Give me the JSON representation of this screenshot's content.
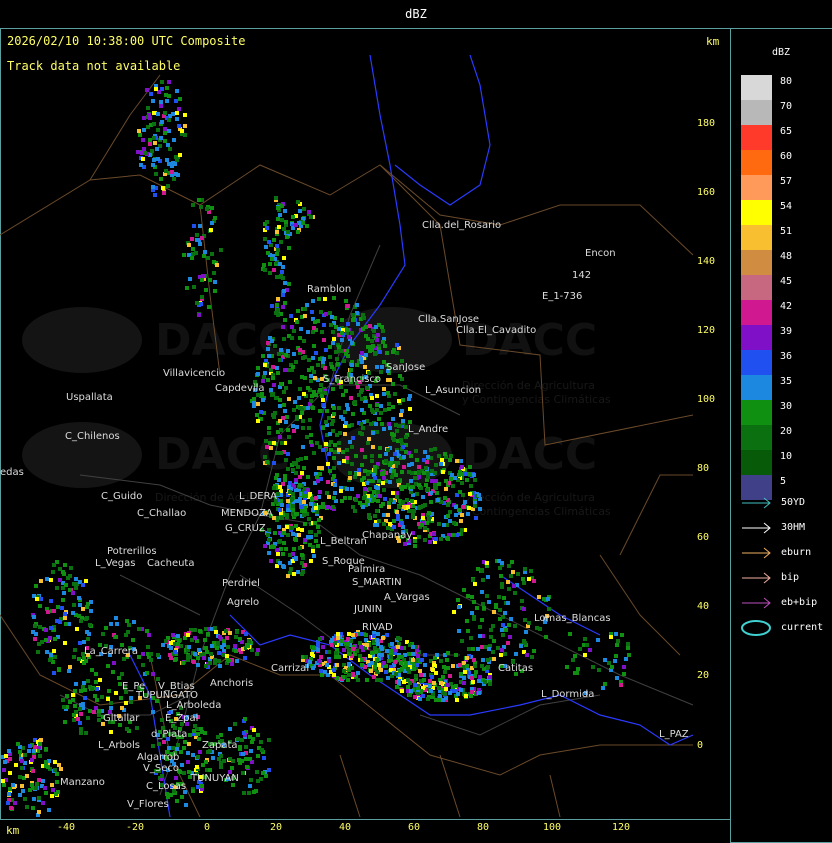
{
  "header": {
    "title": "dBZ"
  },
  "map": {
    "timestamp": "2026/02/10 10:38:00 UTC Composite",
    "track_message": "Track data not available",
    "unit_top": "km",
    "unit_bottom": "km",
    "y_ticks": [
      "180",
      "160",
      "140",
      "120",
      "100",
      "80",
      "60",
      "40",
      "20",
      "0"
    ],
    "x_ticks": [
      "-40",
      "-20",
      "0",
      "20",
      "40",
      "60",
      "80",
      "100",
      "120"
    ],
    "watermark": {
      "brand": "DACC",
      "line1": "Dirección de Agricultura",
      "line2": "y Contingencias Climáticas"
    },
    "places": [
      "Clla.del_Rosario",
      "Encon",
      "142",
      "E_1-736",
      "Ramblon",
      "Clla.SanJose",
      "Clla.El_Cavadito",
      "Villavicencio",
      "Capdevila",
      "S_Francisco",
      "SanJose",
      "L_Asuncion",
      "Uspallata",
      "C_Chilenos",
      "L_Andre",
      "C_Guido",
      "C_Challao",
      "L_DERA",
      "MENDOZA",
      "G_CRUZ",
      "Chapanay",
      "L_Beltran",
      "Potrerillos",
      "L_Vegas",
      "Cacheuta",
      "Perdriel",
      "S_MARTIN",
      "Agrelo",
      "JUNIN",
      "A_Vargas",
      "RIVAD",
      "Lomas_Blancas",
      "La_Carrera",
      "Carrizal",
      "Catitas",
      "E_Pe",
      "V_Btias",
      "Anchoris",
      "TUPUNGATO",
      "L_Arboleda",
      "L_Dormida",
      "Gltallar",
      "E_Zpal",
      "L_PAZ",
      "L_Arbols",
      "d_Plata",
      "Zapata",
      "Algarrob",
      "V_Seco",
      "TUNUYAN",
      "Manzano",
      "C_Losas",
      "V_Flores",
      "Palmira",
      "S_Roque",
      "edas"
    ]
  },
  "legend": {
    "title": "dBZ",
    "levels": [
      {
        "label": "80",
        "color": "#d8d8d8"
      },
      {
        "label": "70",
        "color": "#b8b8b8"
      },
      {
        "label": "65",
        "color": "#ff3a2a"
      },
      {
        "label": "60",
        "color": "#ff6a10"
      },
      {
        "label": "57",
        "color": "#ff9a5a"
      },
      {
        "label": "54",
        "color": "#ffff00"
      },
      {
        "label": "51",
        "color": "#f8c030"
      },
      {
        "label": "48",
        "color": "#d08c40"
      },
      {
        "label": "45",
        "color": "#c86880"
      },
      {
        "label": "42",
        "color": "#d01890"
      },
      {
        "label": "39",
        "color": "#8010c8"
      },
      {
        "label": "36",
        "color": "#2050f0"
      },
      {
        "label": "35",
        "color": "#1c88e0"
      },
      {
        "label": "30",
        "color": "#109010"
      },
      {
        "label": "20",
        "color": "#0a7010"
      },
      {
        "label": "10",
        "color": "#075a08"
      },
      {
        "label": "5",
        "color": "#404088"
      }
    ],
    "tracks": [
      {
        "label": "50YD",
        "color": "#40c0c0"
      },
      {
        "label": "30HM",
        "color": "#ffffff"
      },
      {
        "label": "eburn",
        "color": "#f0b060"
      },
      {
        "label": "bip",
        "color": "#f0b0a0"
      },
      {
        "label": "eb+bip",
        "color": "#c050c0"
      },
      {
        "label": "current",
        "color": "#40d0d0"
      }
    ]
  }
}
